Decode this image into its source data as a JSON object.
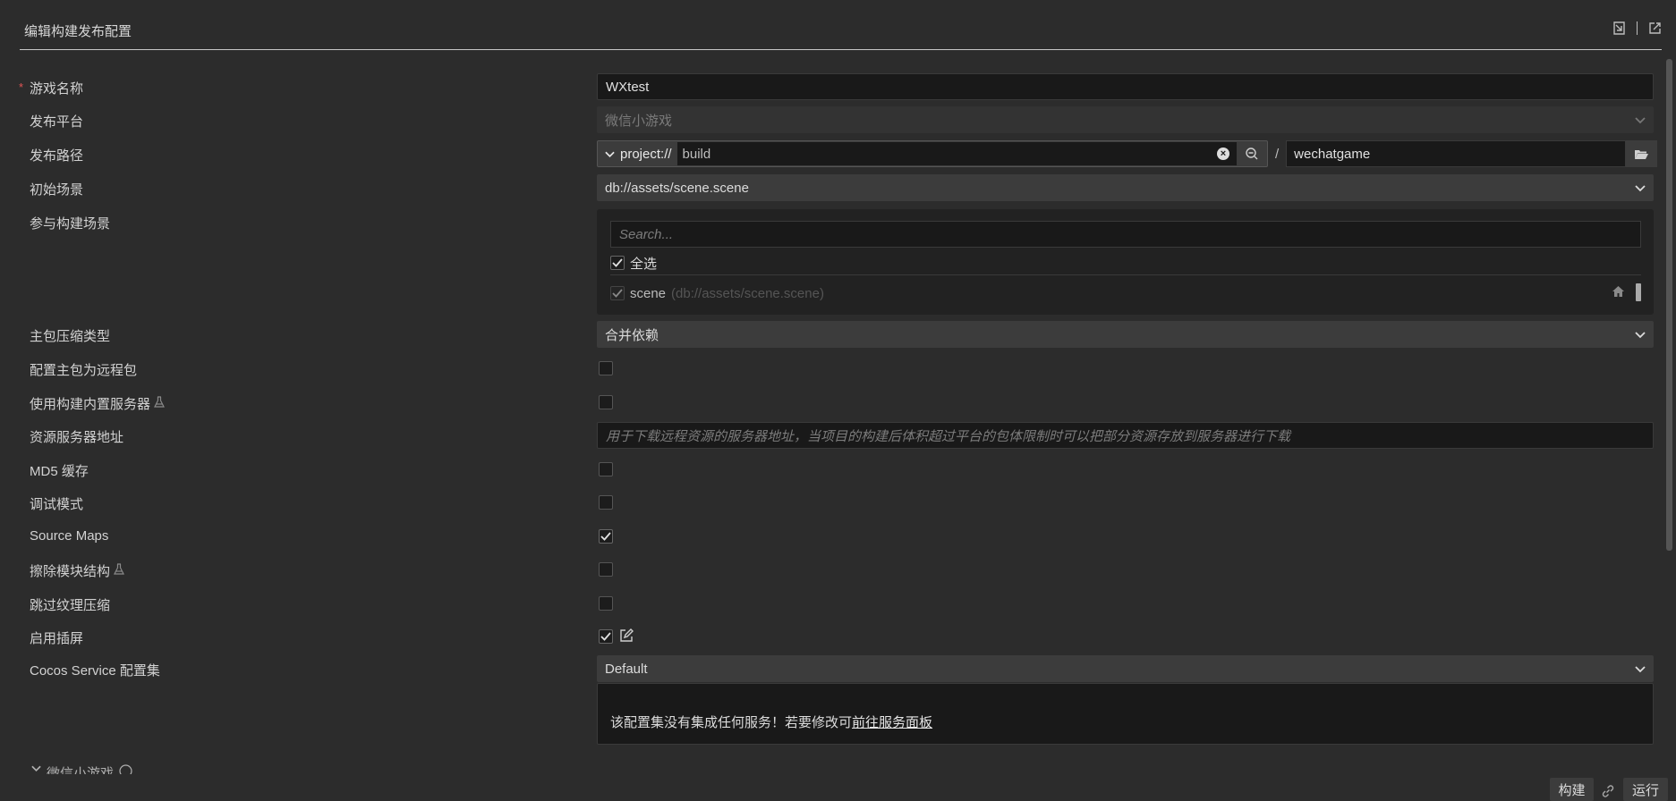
{
  "header": {
    "title": "编辑构建发布配置",
    "import_icon": "import-icon",
    "export_icon": "export-icon"
  },
  "fields": {
    "game_name": {
      "label": "游戏名称",
      "required_mark": "*",
      "value": "WXtest"
    },
    "platform": {
      "label": "发布平台",
      "value": "微信小游戏"
    },
    "build_path": {
      "label": "发布路径",
      "protocol": "project://",
      "path": "build",
      "separator": "/",
      "folder": "wechatgame"
    },
    "start_scene": {
      "label": "初始场景",
      "value": "db://assets/scene.scene"
    },
    "build_scenes": {
      "label": "参与构建场景",
      "search_placeholder": "Search...",
      "select_all_label": "全选",
      "select_all_checked": true,
      "scenes": [
        {
          "name": "scene",
          "path": "(db://assets/scene.scene)",
          "checked": true
        }
      ]
    },
    "compression": {
      "label": "主包压缩类型",
      "value": "合并依赖"
    },
    "main_remote": {
      "label": "配置主包为远程包",
      "checked": false
    },
    "builtin_server": {
      "label": "使用构建内置服务器",
      "checked": false
    },
    "server_address": {
      "label": "资源服务器地址",
      "placeholder": "用于下载远程资源的服务器地址，当项目的构建后体积超过平台的包体限制时可以把部分资源存放到服务器进行下载"
    },
    "md5_cache": {
      "label": "MD5 缓存",
      "checked": false
    },
    "debug_mode": {
      "label": "调试模式",
      "checked": false
    },
    "source_maps": {
      "label": "Source Maps",
      "checked": true
    },
    "remove_module": {
      "label": "擦除模块结构",
      "checked": false
    },
    "skip_texture": {
      "label": "跳过纹理压缩",
      "checked": false
    },
    "splash": {
      "label": "启用插屏",
      "checked": true
    },
    "cocos_service": {
      "label": "Cocos Service 配置集",
      "value": "Default",
      "notice": "该配置集没有集成任何服务！若要修改可",
      "link": "前往服务面板"
    }
  },
  "section": {
    "label": "微信小游戏"
  },
  "footer": {
    "build_label": "构建",
    "run_label": "运行"
  }
}
